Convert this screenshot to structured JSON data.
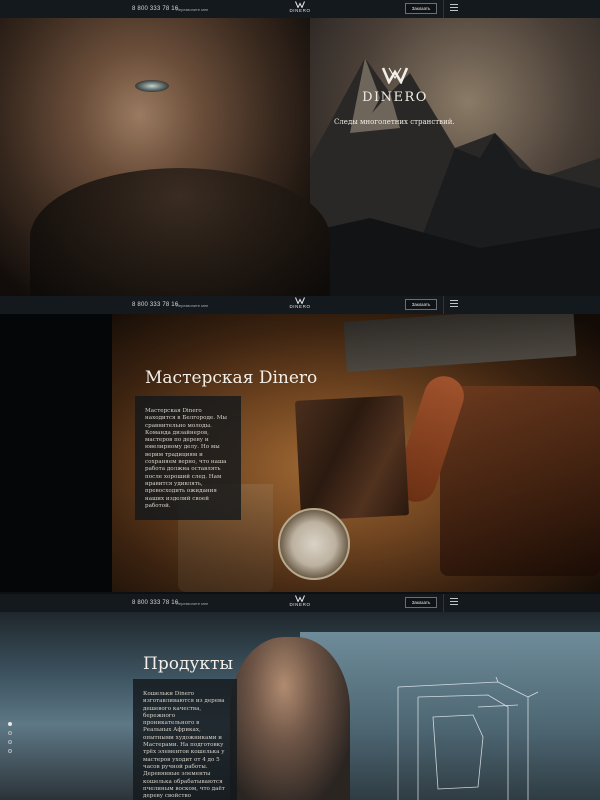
{
  "header": {
    "phone": "8 800 333 78 16",
    "callback": "Перезвоните мне",
    "logo_text": "DINERO",
    "order_label": "Заказать",
    "menu_icon": "hamburger-icon"
  },
  "hero": {
    "brand": "DINERO",
    "tagline": "Следы многолетних странствий."
  },
  "workshop": {
    "title": "Мастерская Dinero",
    "text": "Мастерская Dinero находится в Белгороде. Мы сравнительно молоды. Команда дизайнеров, мастеров по дереву и ювелирному делу. Но мы верим традициям и сохраняем верно, что наша работа должна оставлять после хороший след. Нам нравится удивлять, превосходить ожидания наших изделий своей работой."
  },
  "products": {
    "title": "Продукты",
    "text": "Кошельки Dinero изготавливаются из дерева дешевого качества, бережного проникательного в Реальных Африках, опытными художниками и Мастерами. На подготовку трёх элементов кошелька у мастеров уходит от 4 до 5 часов ручной работы. Деревянные элементы кошелька обрабатываются пчелиным воском, что даёт дереву свойство"
  },
  "colors": {
    "bg": "#0d0f11",
    "header": "#14191d",
    "panel": "#14181c"
  }
}
